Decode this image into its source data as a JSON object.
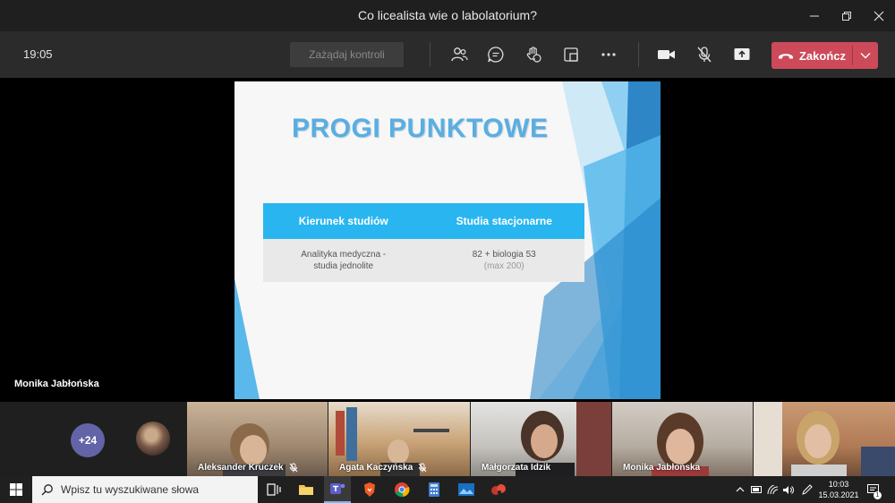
{
  "window": {
    "title": "Co licealista wie o labolatorium?"
  },
  "toolbar": {
    "timer": "19:05",
    "request_control_label": "Zażądaj kontroli",
    "end_call_label": "Zakończ"
  },
  "stage": {
    "presenter_name": "Monika Jabłońska",
    "slide": {
      "title": "PROGI PUNKTOWE",
      "table": {
        "headers": [
          "Kierunek studiów",
          "Studia stacjonarne"
        ],
        "row": {
          "course_line1": "Analityka medyczna -",
          "course_line2": "studia jednolite",
          "points": "82 + biologia 53",
          "points_note": "(max 200)"
        }
      }
    }
  },
  "participants": {
    "more_count": "+24",
    "videos": [
      {
        "name": "Aleksander Kruczek"
      },
      {
        "name": "Agata Kaczyńska"
      },
      {
        "name": "Małgorzata Idzik"
      },
      {
        "name": "Monika Jabłońska"
      }
    ]
  },
  "taskbar": {
    "search_placeholder": "Wpisz tu wyszukiwane słowa",
    "time": "10:03",
    "date": "15.03.2021",
    "notification_count": "1"
  },
  "colors": {
    "accent": "#6264a7",
    "end_call": "#cc4a5a",
    "slide_title": "#5aaee0",
    "table_header": "#29b6f0"
  }
}
